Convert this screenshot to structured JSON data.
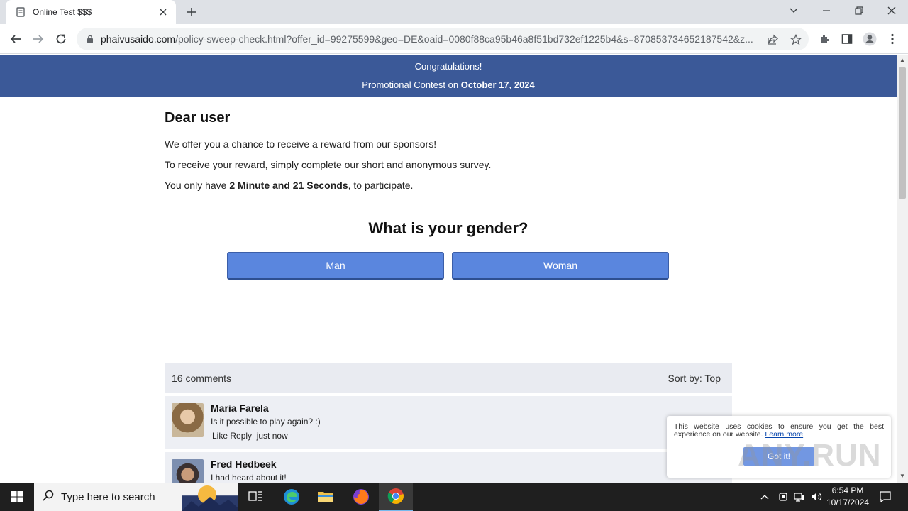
{
  "browser": {
    "tab_title": "Online Test $$$",
    "url_host": "phaivusaido.com",
    "url_path": "/policy-sweep-check.html?offer_id=99275599&geo=DE&oaid=0080f88ca95b46a8f51bd732ef1225b4&s=870853734652187542&z..."
  },
  "banner": {
    "line1": "Congratulations!",
    "line2_prefix": "Promotional Contest on ",
    "line2_date": "October 17, 2024"
  },
  "intro": {
    "heading": "Dear user",
    "p1": "We offer you a chance to receive a reward from our sponsors!",
    "p2": "To receive your reward, simply complete our short and anonymous survey.",
    "p3_prefix": "You only have ",
    "p3_time": "2 Minute and 21 Seconds",
    "p3_suffix": ", to participate."
  },
  "survey": {
    "question": "What is your gender?",
    "answers": [
      "Man",
      "Woman"
    ],
    "button_color": "#5a86de"
  },
  "comments": {
    "count_label": "16 comments",
    "sort_label": "Sort by:",
    "sort_value": "Top",
    "items": [
      {
        "name": "Maria Farela",
        "text": "Is it possible to play again? :)",
        "actions": "Like Reply",
        "time": "just now"
      },
      {
        "name": "Fred Hedbeek",
        "text": "I had heard about it!"
      }
    ]
  },
  "cookie": {
    "text": "This website uses cookies to ensure you get the best experience on our website.",
    "link": "Learn more",
    "button": "Got it!"
  },
  "watermark": "ANY.RUN",
  "taskbar": {
    "search_placeholder": "Type here to search",
    "time": "6:54 PM",
    "date": "10/17/2024"
  },
  "colors": {
    "banner": "#3b5998",
    "taskbar": "#1f1f1f"
  }
}
